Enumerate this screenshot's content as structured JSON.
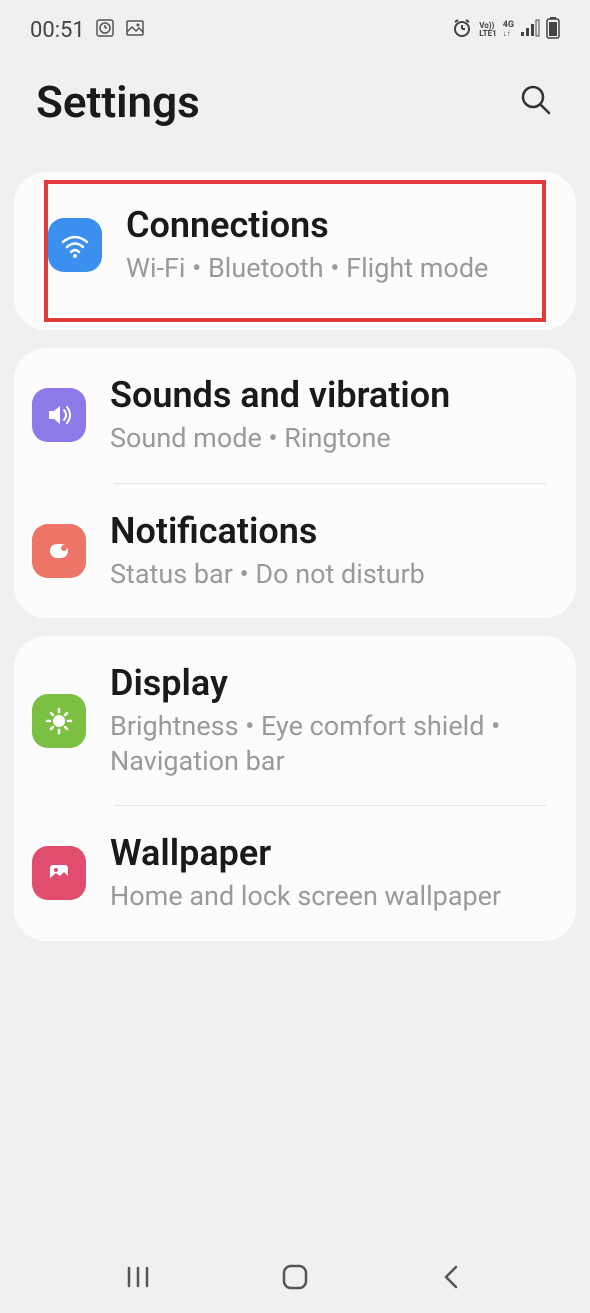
{
  "status": {
    "time": "00:51"
  },
  "header": {
    "title": "Settings"
  },
  "groups": [
    {
      "items": [
        {
          "title": "Connections",
          "subtitle": "Wi-Fi  •  Bluetooth  •  Flight mode"
        }
      ]
    },
    {
      "items": [
        {
          "title": "Sounds and vibration",
          "subtitle": "Sound mode  •  Ringtone"
        },
        {
          "title": "Notifications",
          "subtitle": "Status bar  •  Do not disturb"
        }
      ]
    },
    {
      "items": [
        {
          "title": "Display",
          "subtitle": "Brightness  •  Eye comfort shield  •  Navigation bar"
        },
        {
          "title": "Wallpaper",
          "subtitle": "Home and lock screen wallpaper"
        }
      ]
    }
  ]
}
